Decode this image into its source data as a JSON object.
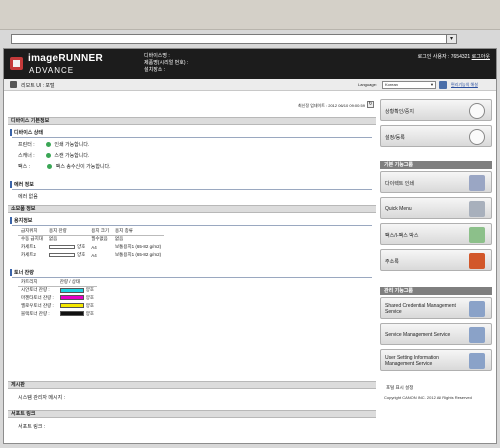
{
  "header": {
    "brand_line1": "imageRUNNER",
    "brand_line2": "ADVANCE",
    "device_name_label": "디바이스명 :",
    "product_name_label": "제품명(시리얼 번호) :",
    "location_label": "설치장소 :",
    "login_user": "로그인 사용자 : 7654321",
    "logout": "로그아웃"
  },
  "subbar": {
    "title": "리모트 UI : 포털",
    "language_label": "Language:",
    "language_value": "Korean",
    "access_link": "편리기능의 해설"
  },
  "update": {
    "label": "최신정 업데이트 :",
    "value": "2012 06/10 09:00:59"
  },
  "device_basic": {
    "section_title": "디바이스 기본정보",
    "status_title": "디바이스 상태",
    "rows": [
      {
        "label": "프린터 :",
        "status": "인쇄 가능합니다."
      },
      {
        "label": "스캐너 :",
        "status": "스캔 가능합니다."
      },
      {
        "label": "팩스 :",
        "status": "팩스 송수신이 가능합니다."
      }
    ]
  },
  "error_info": {
    "title": "에러 정보",
    "value": "에러 없음"
  },
  "consumables": {
    "section_title": "소모품 정보",
    "paper_title": "용지정보",
    "paper_headers": [
      "급지위치",
      "용지 잔량",
      "용지 크기",
      "용지 종류"
    ],
    "paper_rows": [
      {
        "source": "수동 급지대",
        "level": "없음",
        "size": "필수없음",
        "type": "없음"
      },
      {
        "source": "카세트1",
        "level": "양호",
        "size": "A4",
        "type": "보통용지1 (65-82 g/m2)"
      },
      {
        "source": "카세트2",
        "level": "양호",
        "size": "A4",
        "type": "보통용지1 (65-82 g/m2)"
      }
    ],
    "toner_title": "토너 잔량",
    "toner_headers": [
      "카트리지",
      "잔량 / 상태"
    ],
    "toner_rows": [
      {
        "name": "시안토너 잔량 :",
        "color": "#1bd3e0",
        "status": "양호"
      },
      {
        "name": "마젠타토너 잔량 :",
        "color": "#e600c8",
        "status": "양호"
      },
      {
        "name": "옐로우토너 잔량 :",
        "color": "#f5e800",
        "status": "양호"
      },
      {
        "name": "블랙토너 잔량 :",
        "color": "#111111",
        "status": "양호"
      }
    ]
  },
  "message": {
    "section_title": "게시판",
    "value": "시스템 관리자 메시지 :"
  },
  "support": {
    "section_title": "서포트 링크",
    "value": "서포트 링크 :"
  },
  "sidebar": {
    "top_buttons": [
      "상황확인/중지",
      "설정/등록"
    ],
    "basic_head": "기본 기능그룹",
    "basic_buttons": [
      "다이렉트 인쇄",
      "Quick Menu",
      "팩스/I-팩스 박스",
      "주소록"
    ],
    "manage_head": "관리 기능그룹",
    "manage_buttons": [
      "Shared Credential Management Service",
      "Service Management Service",
      "User Setting Information Management Service"
    ],
    "portal_link": "포털 표시 설정"
  },
  "footer": {
    "copyright": "Copyright CANON INC. 2012 All Rights Reserved"
  }
}
